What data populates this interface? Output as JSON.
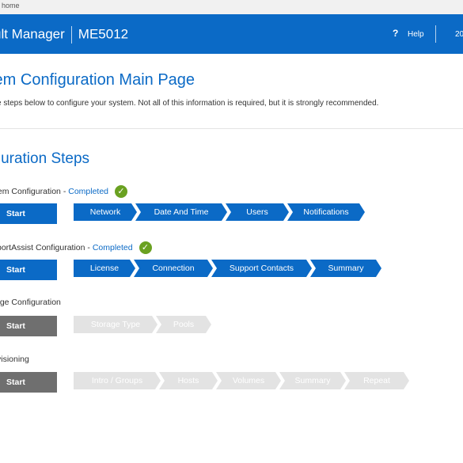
{
  "browser": {
    "url_fragment": "home"
  },
  "header": {
    "app_title": "ult Manager",
    "model": "ME5012",
    "help_icon": "?",
    "help_label": "Help",
    "right_text": "20"
  },
  "page": {
    "title": "tem Configuration Main Page",
    "intro": "e steps below to configure your system. Not all of this information is required, but it is strongly recommended."
  },
  "section": {
    "title": "figuration Steps"
  },
  "groups": [
    {
      "label": "tem Configuration",
      "separator": "-",
      "status": "Completed",
      "check_icon": "✓",
      "start": "Start",
      "steps": [
        "Network",
        "Date And Time",
        "Users",
        "Notifications"
      ]
    },
    {
      "label": "portAssist Configuration",
      "separator": "-",
      "status": "Completed",
      "check_icon": "✓",
      "start": "Start",
      "steps": [
        "License",
        "Connection",
        "Support Contacts",
        "Summary"
      ]
    },
    {
      "label": "age Configuration",
      "start": "Start",
      "steps": [
        "Storage Type",
        "Pools"
      ]
    },
    {
      "label": "visioning",
      "start": "Start",
      "steps": [
        "Intro / Groups",
        "Hosts",
        "Volumes",
        "Summary",
        "Repeat"
      ]
    }
  ],
  "colors": {
    "brand_blue": "#0b6ac6",
    "completed_green": "#6aa121",
    "disabled_step": "#e3e3e3",
    "disabled_start": "#6f6f6f"
  }
}
